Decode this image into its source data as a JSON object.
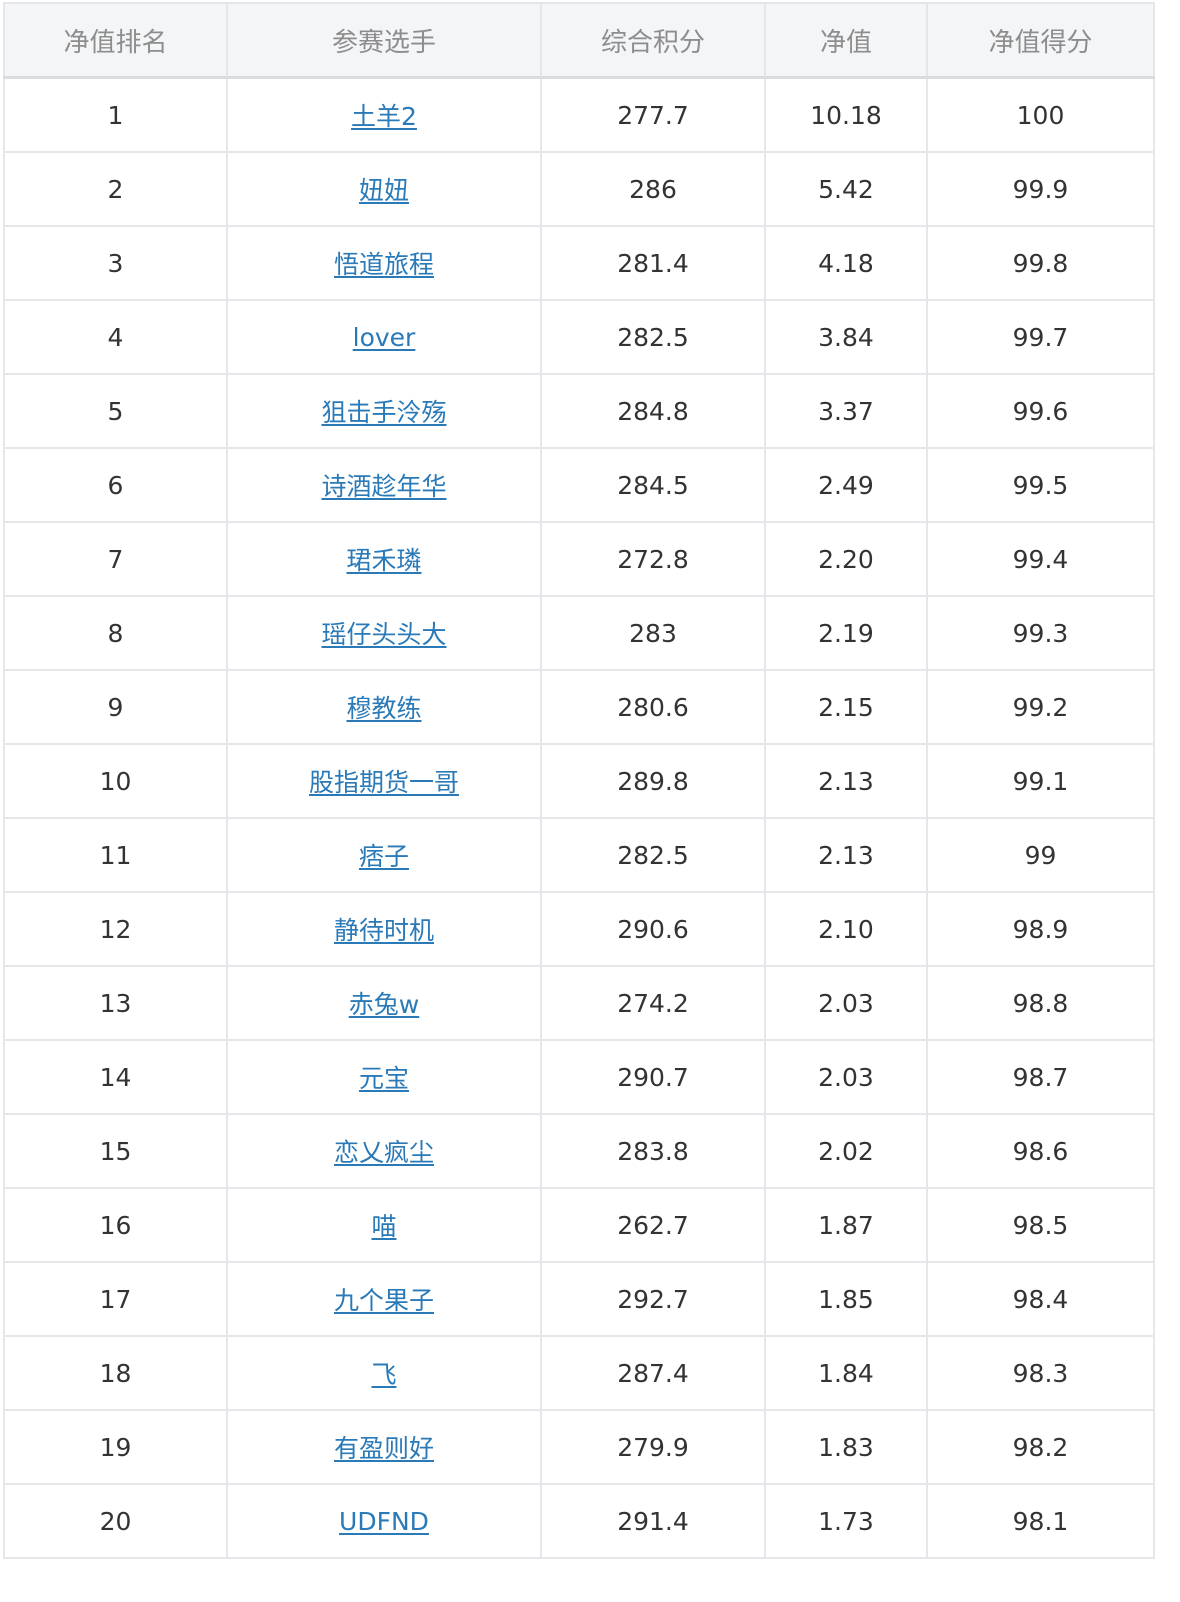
{
  "table": {
    "columns": [
      "净值排名",
      "参赛选手",
      "综合积分",
      "净值",
      "净值得分"
    ],
    "rows": [
      {
        "rank": "1",
        "player": "土羊2",
        "score": "277.7",
        "nav": "10.18",
        "nav_score": "100"
      },
      {
        "rank": "2",
        "player": "妞妞",
        "score": "286",
        "nav": "5.42",
        "nav_score": "99.9"
      },
      {
        "rank": "3",
        "player": "悟道旅程",
        "score": "281.4",
        "nav": "4.18",
        "nav_score": "99.8"
      },
      {
        "rank": "4",
        "player": "lover",
        "score": "282.5",
        "nav": "3.84",
        "nav_score": "99.7"
      },
      {
        "rank": "5",
        "player": "狙击手泠殇",
        "score": "284.8",
        "nav": "3.37",
        "nav_score": "99.6"
      },
      {
        "rank": "6",
        "player": "诗酒趁年华",
        "score": "284.5",
        "nav": "2.49",
        "nav_score": "99.5"
      },
      {
        "rank": "7",
        "player": "珺禾璘",
        "score": "272.8",
        "nav": "2.20",
        "nav_score": "99.4"
      },
      {
        "rank": "8",
        "player": "瑶仔头头大",
        "score": "283",
        "nav": "2.19",
        "nav_score": "99.3"
      },
      {
        "rank": "9",
        "player": "穆教练",
        "score": "280.6",
        "nav": "2.15",
        "nav_score": "99.2"
      },
      {
        "rank": "10",
        "player": "股指期货一哥",
        "score": "289.8",
        "nav": "2.13",
        "nav_score": "99.1"
      },
      {
        "rank": "11",
        "player": "痞子",
        "score": "282.5",
        "nav": "2.13",
        "nav_score": "99"
      },
      {
        "rank": "12",
        "player": "静待时机",
        "score": "290.6",
        "nav": "2.10",
        "nav_score": "98.9"
      },
      {
        "rank": "13",
        "player": "赤兔w",
        "score": "274.2",
        "nav": "2.03",
        "nav_score": "98.8"
      },
      {
        "rank": "14",
        "player": "元宝",
        "score": "290.7",
        "nav": "2.03",
        "nav_score": "98.7"
      },
      {
        "rank": "15",
        "player": "恋乂疯尘",
        "score": "283.8",
        "nav": "2.02",
        "nav_score": "98.6"
      },
      {
        "rank": "16",
        "player": "喵",
        "score": "262.7",
        "nav": "1.87",
        "nav_score": "98.5"
      },
      {
        "rank": "17",
        "player": "九个果子",
        "score": "292.7",
        "nav": "1.85",
        "nav_score": "98.4"
      },
      {
        "rank": "18",
        "player": "飞",
        "score": "287.4",
        "nav": "1.84",
        "nav_score": "98.3"
      },
      {
        "rank": "19",
        "player": "有盈则好",
        "score": "279.9",
        "nav": "1.83",
        "nav_score": "98.2"
      },
      {
        "rank": "20",
        "player": "UDFND",
        "score": "291.4",
        "nav": "1.73",
        "nav_score": "98.1"
      }
    ]
  },
  "colors": {
    "link": "#2b7ab8",
    "header_bg": "#f4f5f7",
    "header_text": "#8d8d8d",
    "cell_text": "#333333",
    "border": "#e6e7ea"
  }
}
